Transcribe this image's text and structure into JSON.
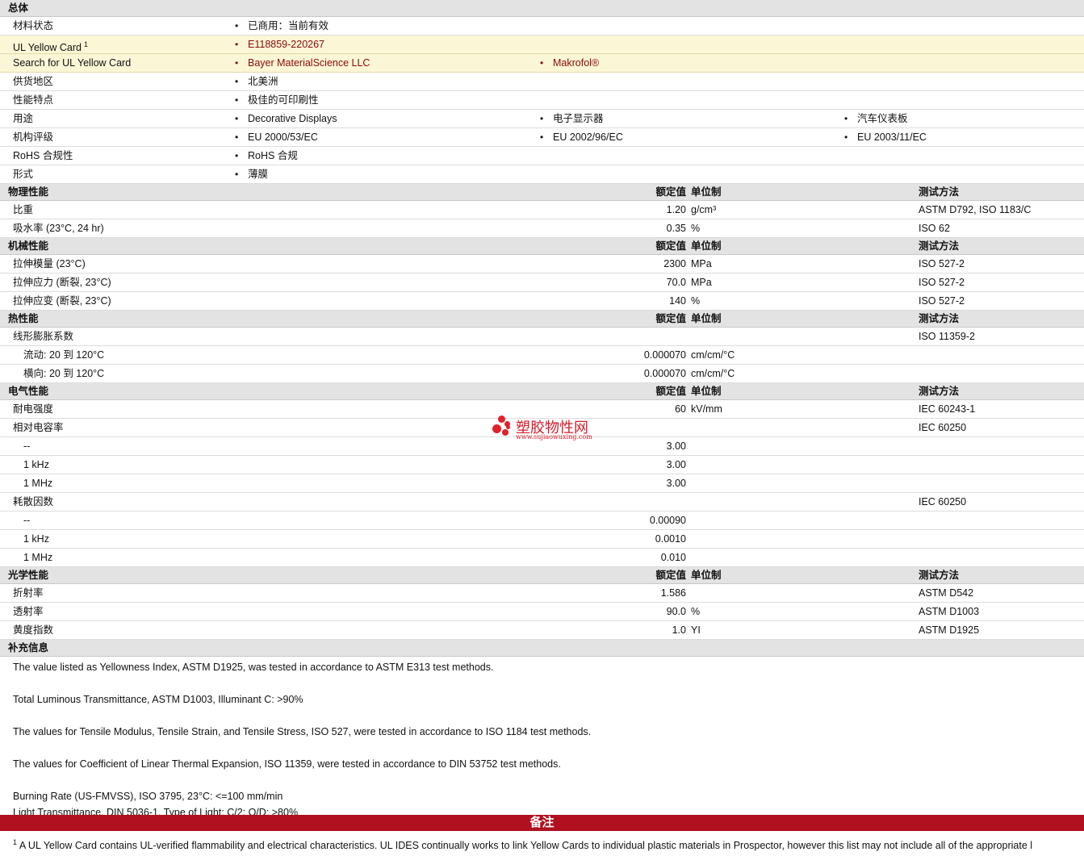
{
  "general": {
    "title": "总体",
    "rows": [
      {
        "label": "材料状态",
        "items": [
          "已商用：当前有效"
        ]
      },
      {
        "label": "UL Yellow Card",
        "sup": "1",
        "items": [
          "E118859-220267"
        ]
      },
      {
        "label": "Search for UL Yellow Card",
        "items": [
          "Bayer MaterialScience LLC",
          "Makrofol®"
        ]
      },
      {
        "label": "供货地区",
        "items": [
          "北美洲"
        ]
      },
      {
        "label": "性能特点",
        "items": [
          "极佳的可印刷性"
        ]
      },
      {
        "label": "用途",
        "items": [
          "Decorative Displays",
          "电子显示器",
          "汽车仪表板"
        ]
      },
      {
        "label": "机构评级",
        "items": [
          "EU 2000/53/EC",
          "EU 2002/96/EC",
          "EU 2003/11/EC"
        ]
      },
      {
        "label": "RoHS 合规性",
        "items": [
          "RoHS 合规"
        ]
      },
      {
        "label": "形式",
        "items": [
          "薄膜"
        ]
      }
    ]
  },
  "col_headers": {
    "value": "额定值",
    "unit": "单位制",
    "method": "测试方法"
  },
  "physical": {
    "title": "物理性能",
    "rows": [
      {
        "label": "比重",
        "value": "1.20",
        "unit": "g/cm³",
        "method": "ASTM D792, ISO 1183/C"
      },
      {
        "label": "吸水率 (23°C, 24 hr)",
        "value": "0.35",
        "unit": "%",
        "method": "ISO 62"
      }
    ]
  },
  "mechanical": {
    "title": "机械性能",
    "rows": [
      {
        "label": "拉伸模量 (23°C)",
        "value": "2300",
        "unit": "MPa",
        "method": "ISO 527-2"
      },
      {
        "label": "拉伸应力 (断裂, 23°C)",
        "value": "70.0",
        "unit": "MPa",
        "method": "ISO 527-2"
      },
      {
        "label": "拉伸应变 (断裂, 23°C)",
        "value": "140",
        "unit": "%",
        "method": "ISO 527-2"
      }
    ]
  },
  "thermal": {
    "title": "热性能",
    "rows": [
      {
        "label": "线形膨胀系数",
        "value": "",
        "unit": "",
        "method": "ISO 11359-2"
      },
      {
        "label": "流动: 20 到 120°C",
        "value": "0.000070",
        "unit": "cm/cm/°C",
        "method": ""
      },
      {
        "label": "横向: 20 到 120°C",
        "value": "0.000070",
        "unit": "cm/cm/°C",
        "method": ""
      }
    ]
  },
  "electrical": {
    "title": "电气性能",
    "rows": [
      {
        "label": "耐电强度",
        "value": "60",
        "unit": "kV/mm",
        "method": "IEC 60243-1"
      },
      {
        "label": "相对电容率",
        "value": "",
        "unit": "",
        "method": "IEC 60250"
      },
      {
        "label": "--",
        "value": "3.00",
        "unit": "",
        "method": ""
      },
      {
        "label": "1 kHz",
        "value": "3.00",
        "unit": "",
        "method": ""
      },
      {
        "label": "1 MHz",
        "value": "3.00",
        "unit": "",
        "method": ""
      },
      {
        "label": "耗散因数",
        "value": "",
        "unit": "",
        "method": "IEC 60250"
      },
      {
        "label": "--",
        "value": "0.00090",
        "unit": "",
        "method": ""
      },
      {
        "label": "1 kHz",
        "value": "0.0010",
        "unit": "",
        "method": ""
      },
      {
        "label": "1 MHz",
        "value": "0.010",
        "unit": "",
        "method": ""
      }
    ]
  },
  "optical": {
    "title": "光学性能",
    "rows": [
      {
        "label": "折射率",
        "value": "1.586",
        "unit": "",
        "method": "ASTM D542"
      },
      {
        "label": "透射率",
        "value": "90.0",
        "unit": "%",
        "method": "ASTM D1003"
      },
      {
        "label": "黄度指数",
        "value": "1.0",
        "unit": "YI",
        "method": "ASTM D1925"
      }
    ]
  },
  "supplemental": {
    "title": "补充信息",
    "notes": [
      "The value listed as Yellowness Index, ASTM D1925, was tested in accordance to ASTM E313 test methods.",
      "Total Luminous Transmittance, ASTM D1003, Illuminant C: >90%",
      "The values for Tensile Modulus, Tensile Strain, and Tensile Stress, ISO 527, were tested in accordance to ISO 1184 test methods.",
      "The values for Coefficient of Linear Thermal Expansion, ISO 11359, were tested in accordance to DIN 53752 test methods.",
      "Burning Rate (US-FMVSS), ISO 3795, 23°C: <=100 mm/min",
      "Light Transmittance, DIN 5036-1, Type of Light; C/2; O/D: >80%"
    ]
  },
  "remarks": {
    "title": "备注",
    "footnote_num": "1",
    "footnote": "A UL Yellow Card contains UL-verified flammability and electrical characteristics. UL IDES continually works to link Yellow Cards to individual plastic materials in Prospector, however this list may not include all of the appropriate l"
  },
  "watermark": {
    "name": "塑胶物性网",
    "url": "www.sujiaowuxing.com"
  }
}
